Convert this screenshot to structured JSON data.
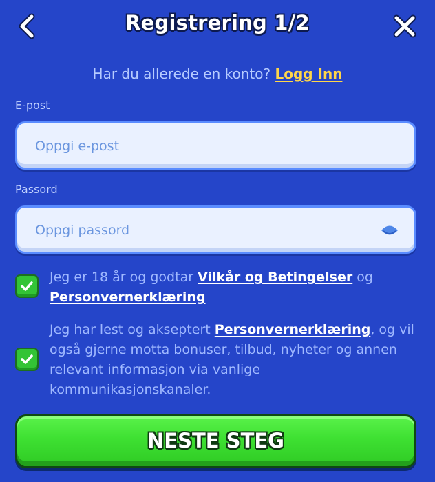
{
  "header": {
    "title": "Registrering 1/2",
    "back_icon": "chevron-left-icon",
    "close_icon": "close-icon"
  },
  "login": {
    "prompt": "Har du allerede en konto?",
    "link_label": "Logg Inn"
  },
  "email": {
    "label": "E-post",
    "placeholder": "Oppgi e-post",
    "value": ""
  },
  "password": {
    "label": "Passord",
    "placeholder": "Oppgi passord",
    "value": "",
    "toggle_icon": "eye-icon"
  },
  "terms": {
    "checked": true,
    "text_before": "Jeg er 18 år og godtar",
    "link1": "Vilkår og Betingelser",
    "text_mid": "og",
    "link2": "Personvernerklæring"
  },
  "marketing": {
    "checked": true,
    "text_before": "Jeg har lest og akseptert",
    "link": "Personvernerklæring",
    "text_after": ", og vil også gjerne motta bonuser, tilbud, nyheter og annen relevant informasjon via vanlige kommunikasjonskanaler."
  },
  "next_button": {
    "label": "NESTE STEG"
  },
  "colors": {
    "background": "#2545c9",
    "accent_link": "#ffd64a",
    "button_green": "#3ee032",
    "checkbox_green": "#33c436"
  }
}
